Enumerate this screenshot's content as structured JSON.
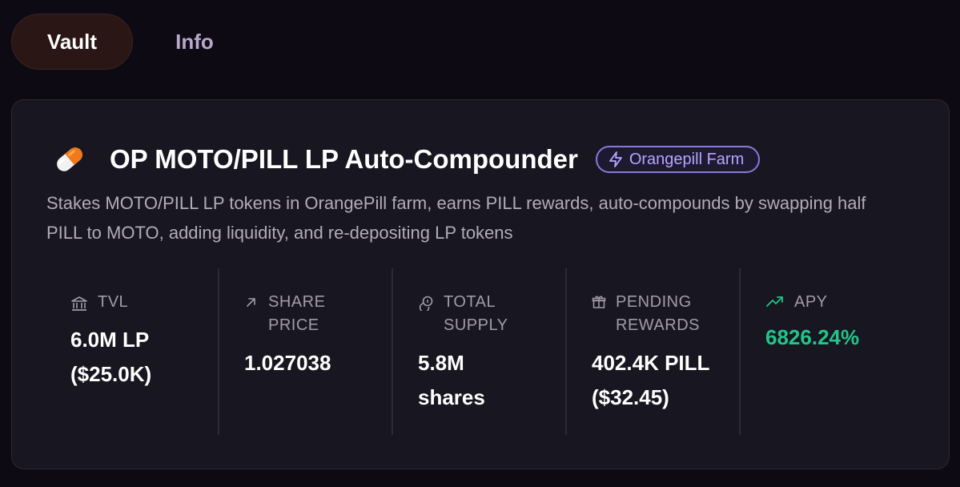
{
  "tabs": [
    {
      "label": "Vault",
      "active": true
    },
    {
      "label": "Info",
      "active": false
    }
  ],
  "vault": {
    "title": "OP MOTO/PILL LP Auto-Compounder",
    "icon": "pill-icon",
    "badge": {
      "label": "Orangepill Farm",
      "icon": "lightning-icon"
    },
    "description": "Stakes MOTO/PILL LP tokens in OrangePill farm, earns PILL rewards, auto-compounds by swapping half PILL to MOTO, adding liquidity, and re-depositing LP tokens"
  },
  "stats": {
    "tvl": {
      "label": "TVL",
      "icon": "bank-icon",
      "value_line1": "6.0M LP",
      "value_line2": "($25.0K)"
    },
    "share_price": {
      "label": "SHARE PRICE",
      "icon": "arrow-up-right-icon",
      "value": "1.027038"
    },
    "total_supply": {
      "label": "TOTAL SUPPLY",
      "icon": "coins-icon",
      "value": "5.8M shares"
    },
    "pending_rewards": {
      "label": "PENDING REWARDS",
      "icon": "gift-icon",
      "value_line1": "402.4K PILL",
      "value_line2": "($32.45)"
    },
    "apy": {
      "label": "APY",
      "icon": "trending-up-icon",
      "value": "6826.24%"
    }
  },
  "colors": {
    "background": "#0d0a13",
    "card": "#181620",
    "accent_green": "#22c58a",
    "badge_purple": "#b7a6ff",
    "active_tab": "#2a1614"
  }
}
